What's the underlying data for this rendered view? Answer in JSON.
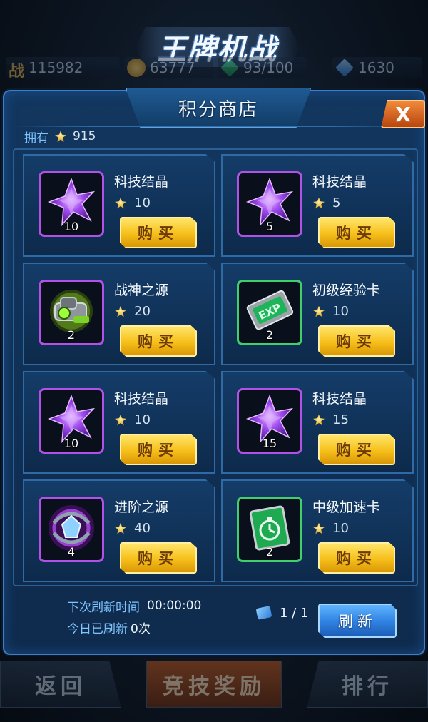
{
  "game": {
    "logo_text": "王牌机战"
  },
  "resources": {
    "battle_label": "战",
    "battle_power": "115982",
    "gold": "63777",
    "stamina": "93/100",
    "diamonds": "1630"
  },
  "bottom_nav": {
    "back": "返回",
    "reward": "竞技奖励",
    "rank": "排行"
  },
  "shop": {
    "title": "积分商店",
    "close": "X",
    "owned_label": "拥有",
    "owned_points": "915",
    "items": [
      {
        "name": "科技结晶",
        "price": "10",
        "qty": "10",
        "icon": "crystal-icon",
        "rarity": "purple",
        "buy": "购买"
      },
      {
        "name": "科技结晶",
        "price": "5",
        "qty": "5",
        "icon": "crystal-icon",
        "rarity": "purple",
        "buy": "购买"
      },
      {
        "name": "战神之源",
        "price": "20",
        "qty": "2",
        "icon": "gear-icon",
        "rarity": "purple",
        "buy": "购买"
      },
      {
        "name": "初级经验卡",
        "price": "10",
        "qty": "2",
        "icon": "exp-card-icon",
        "rarity": "green",
        "buy": "购买"
      },
      {
        "name": "科技结晶",
        "price": "10",
        "qty": "10",
        "icon": "crystal-icon",
        "rarity": "purple",
        "buy": "购买"
      },
      {
        "name": "科技结晶",
        "price": "15",
        "qty": "15",
        "icon": "crystal-icon",
        "rarity": "purple",
        "buy": "购买"
      },
      {
        "name": "进阶之源",
        "price": "40",
        "qty": "4",
        "icon": "orb-icon",
        "rarity": "purple",
        "buy": "购买"
      },
      {
        "name": "中级加速卡",
        "price": "10",
        "qty": "2",
        "icon": "speed-card-icon",
        "rarity": "green",
        "buy": "购买"
      }
    ],
    "next_refresh_label": "下次刷新时间",
    "next_refresh_time": "00:00:00",
    "today_refreshed_label": "今日已刷新",
    "today_refreshed_count": "0次",
    "page": "1 / 1",
    "refresh_button": "刷新"
  },
  "colors": {
    "accent_blue": "#3f7ec2",
    "buy_yellow": "#f6bf1a",
    "rarity_purple": "#b251e8",
    "rarity_green": "#3fd06b",
    "label_cyan": "#7fc4ff"
  }
}
